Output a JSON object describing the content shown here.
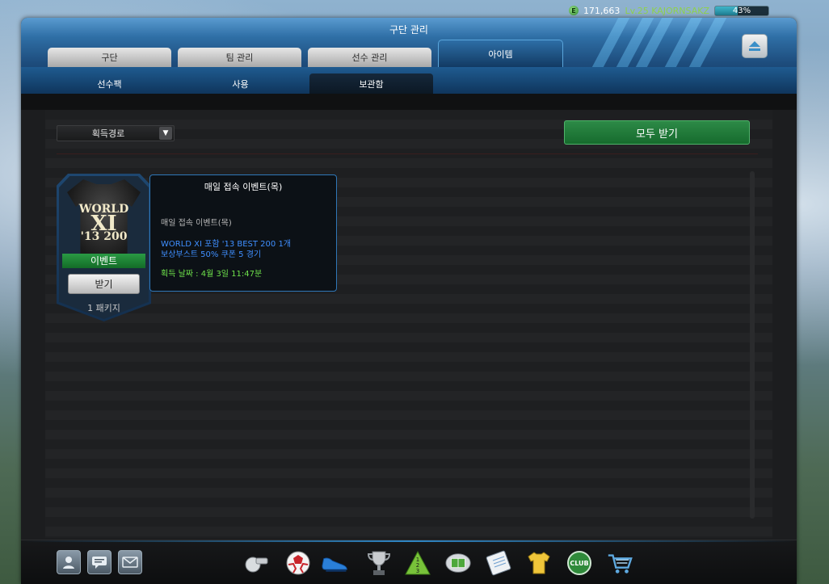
{
  "topbar": {
    "coins": "171,663",
    "level": "Lv.25 KAJORNSAKZ",
    "xp_percent": 43,
    "xp_label": "43%"
  },
  "window": {
    "title": "구단 관리"
  },
  "tabs": [
    {
      "label": "구단"
    },
    {
      "label": "팀 관리"
    },
    {
      "label": "선수 관리"
    },
    {
      "label": "아이템",
      "active": true
    }
  ],
  "subtabs": [
    {
      "label": "선수팩"
    },
    {
      "label": "사용"
    },
    {
      "label": "보관함",
      "active": true
    }
  ],
  "filter": {
    "label": "획득경로"
  },
  "receive_all_label": "모두 받기",
  "item": {
    "jersey_text": [
      "WORLD",
      "XI",
      "'13 200"
    ],
    "band_label": "이벤트",
    "claim_label": "받기",
    "package_label": "1 패키지"
  },
  "tooltip": {
    "title": "매일 접속 이벤트(목)",
    "subtitle": "매일 접속 이벤트(목)",
    "line1": "WORLD XI 포함 '13 BEST 200 1개",
    "line2": "보상부스트 50% 쿠폰 5 경기",
    "date": "획득 날짜 : 4월 3일 11:47분"
  },
  "colors": {
    "accent_blue": "#2f77b7",
    "receive_green": "#1f7a3a",
    "tooltip_highlight": "#3f8fff",
    "tooltip_date": "#6ee14b"
  },
  "bottom": {
    "left_buttons": [
      "profile-icon",
      "chat-icon",
      "mail-icon"
    ],
    "tools": [
      "whistle-icon",
      "soccer-ball-icon",
      "boot-icon",
      "trophy-icon",
      "ranking-pyramid-icon",
      "stadium-icon",
      "notepad-icon",
      "jersey-icon",
      "club-icon",
      "shop-cart-icon"
    ],
    "club_label": "CLUB"
  }
}
